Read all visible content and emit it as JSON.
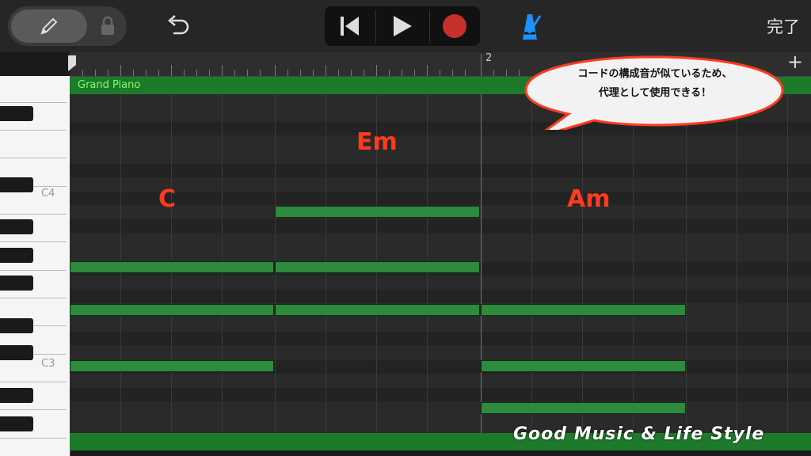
{
  "toolbar": {
    "tools": [
      "pencil-icon",
      "lock-icon"
    ],
    "undo_icon": "undo-icon",
    "transport": [
      "skip-back-icon",
      "play-icon",
      "record-icon"
    ],
    "metronome_icon": "metronome-icon",
    "done_label": "完了"
  },
  "ruler": {
    "bar_label": "2",
    "add_icon": "+"
  },
  "track": {
    "name": "Grand Piano"
  },
  "keyboard": {
    "labels": [
      "C4",
      "C3"
    ]
  },
  "chords": {
    "c": "C",
    "em": "Em",
    "am": "Am"
  },
  "callout": {
    "line1": "コードの構成音が似ているため、",
    "line2": "代理として使用できる！"
  },
  "watermark": "Good Music & Life Style",
  "colors": {
    "note": "#2e8a3c",
    "region": "#1d7a2a",
    "chord_label": "#ff3b1f",
    "record": "#c8302b",
    "metronome": "#1e90ff"
  }
}
